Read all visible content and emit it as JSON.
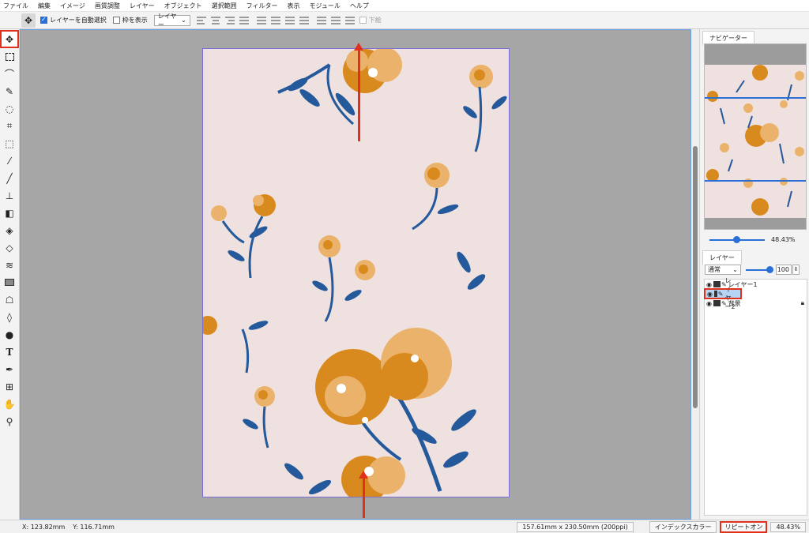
{
  "menu": [
    "ファイル",
    "編集",
    "イメージ",
    "画質調整",
    "レイヤー",
    "オブジェクト",
    "選択範囲",
    "フィルター",
    "表示",
    "モジュール",
    "ヘルプ"
  ],
  "options": {
    "auto_select_label": "レイヤーを自動選択",
    "show_frame_label": "枠を表示",
    "target_select": "レイヤー",
    "bottom_label": "下絵"
  },
  "tools": [
    "move-tool",
    "marquee-tool",
    "lasso-tool",
    "magic-wand-tool",
    "quick-select-tool",
    "crop-tool",
    "transform-tool",
    "eyedropper-tool",
    "brush-tool",
    "stamp-tool",
    "eraser-tool",
    "fill-tool",
    "paint-bucket-tool",
    "gradient-tool",
    "rectangle-tool",
    "smudge-tool",
    "drop-tool",
    "blur-tool",
    "text-tool",
    "pen-tool",
    "grid-tool",
    "hand-tool",
    "zoom-tool"
  ],
  "navigator": {
    "tab_label": "ナビゲーター",
    "zoom_value": "48.43%"
  },
  "layers_panel": {
    "tab_label": "レイヤー",
    "blend_mode": "通常",
    "opacity": "100",
    "layers": [
      {
        "name": "レイヤー1",
        "selected": false,
        "locked": false
      },
      {
        "name": "レイヤー2",
        "selected": true,
        "locked": false
      },
      {
        "name": "背景",
        "selected": false,
        "locked": true
      }
    ]
  },
  "status": {
    "x": "X: 123.82mm",
    "y": "Y: 116.71mm",
    "doc_size": "157.61mm x 230.50mm (200ppi)",
    "color_mode": "インデックスカラー",
    "repeat": "リピートオン",
    "zoom": "48.43%"
  },
  "colors": {
    "accent": "#2a6fd6",
    "highlight": "#e0301e",
    "doc_bg": "#efe1df",
    "flower_orange": "#d98a1e",
    "flower_light": "#eab26a",
    "leaf_blue": "#24599b"
  }
}
